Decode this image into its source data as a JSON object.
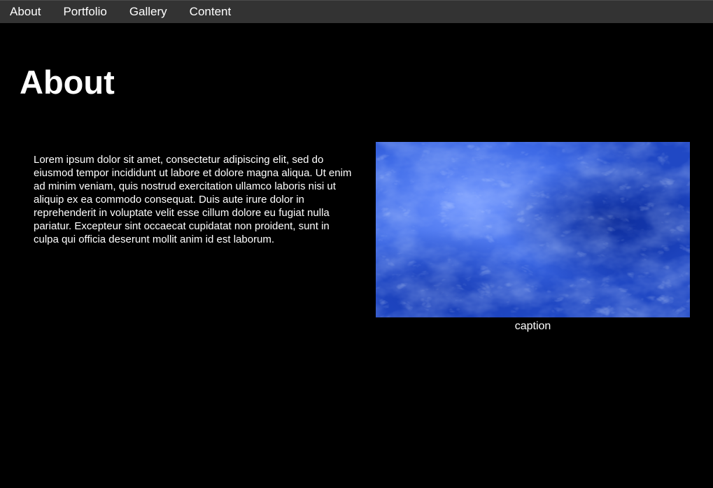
{
  "nav": {
    "items": [
      {
        "label": "About"
      },
      {
        "label": "Portfolio"
      },
      {
        "label": "Gallery"
      },
      {
        "label": "Content"
      }
    ]
  },
  "main": {
    "title": "About",
    "paragraph": "Lorem ipsum dolor sit amet, consectetur adipiscing elit, sed do eiusmod tempor incididunt ut labore et dolore magna aliqua. Ut enim ad minim veniam, quis nostrud exercitation ullamco laboris nisi ut aliquip ex ea commodo consequat. Duis aute irure dolor in reprehenderit in voluptate velit esse cillum dolore eu fugiat nulla pariatur. Excepteur sint occaecat cupidatat non proident, sunt in culpa qui officia deserunt mollit anim id est laborum.",
    "figure": {
      "caption": "caption"
    }
  },
  "colors": {
    "background": "#000000",
    "navbar": "#333333",
    "text": "#ffffff",
    "image_blue": "#3f6fe0"
  }
}
